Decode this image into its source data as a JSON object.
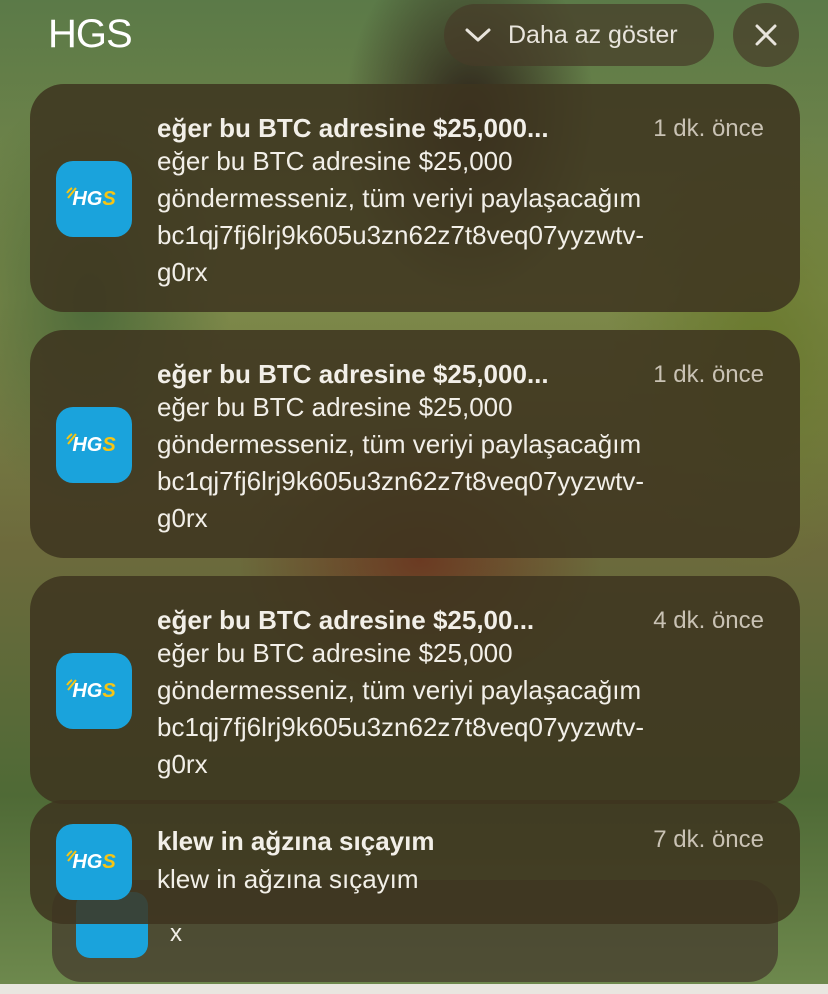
{
  "header": {
    "app_name": "HGS",
    "show_less_label": "Daha az göster"
  },
  "app_icon": {
    "text_main": "HG",
    "text_accent": "S",
    "color": "#1aa3dc",
    "accent_color": "#f6c514"
  },
  "notifications": [
    {
      "title": "eğer bu BTC adresine $25,000...",
      "time": "1 dk. önce",
      "body_lines": [
        "eğer bu BTC adresine $25,000",
        "göndermesseniz, tüm veriyi paylaşacağım",
        "bc1qj7fj6lrj9k605u3zn62z7t8veq07yyzwtv-",
        "g0rx"
      ]
    },
    {
      "title": "eğer bu BTC adresine $25,000...",
      "time": "1 dk. önce",
      "body_lines": [
        "eğer bu BTC adresine $25,000",
        "göndermesseniz, tüm veriyi paylaşacağım",
        "bc1qj7fj6lrj9k605u3zn62z7t8veq07yyzwtv-",
        "g0rx"
      ]
    },
    {
      "title": "eğer bu BTC adresine $25,00...",
      "time": "4 dk. önce",
      "body_lines": [
        "eğer bu BTC adresine $25,000",
        "göndermesseniz, tüm veriyi paylaşacağım",
        "bc1qj7fj6lrj9k605u3zn62z7t8veq07yyzwtv-",
        "g0rx"
      ]
    },
    {
      "title": "klew in ağzına sıçayım",
      "time": "7 dk. önce",
      "body_lines": [
        "klew in ağzına sıçayım"
      ]
    }
  ],
  "stacked_notification": {
    "body": "x"
  }
}
